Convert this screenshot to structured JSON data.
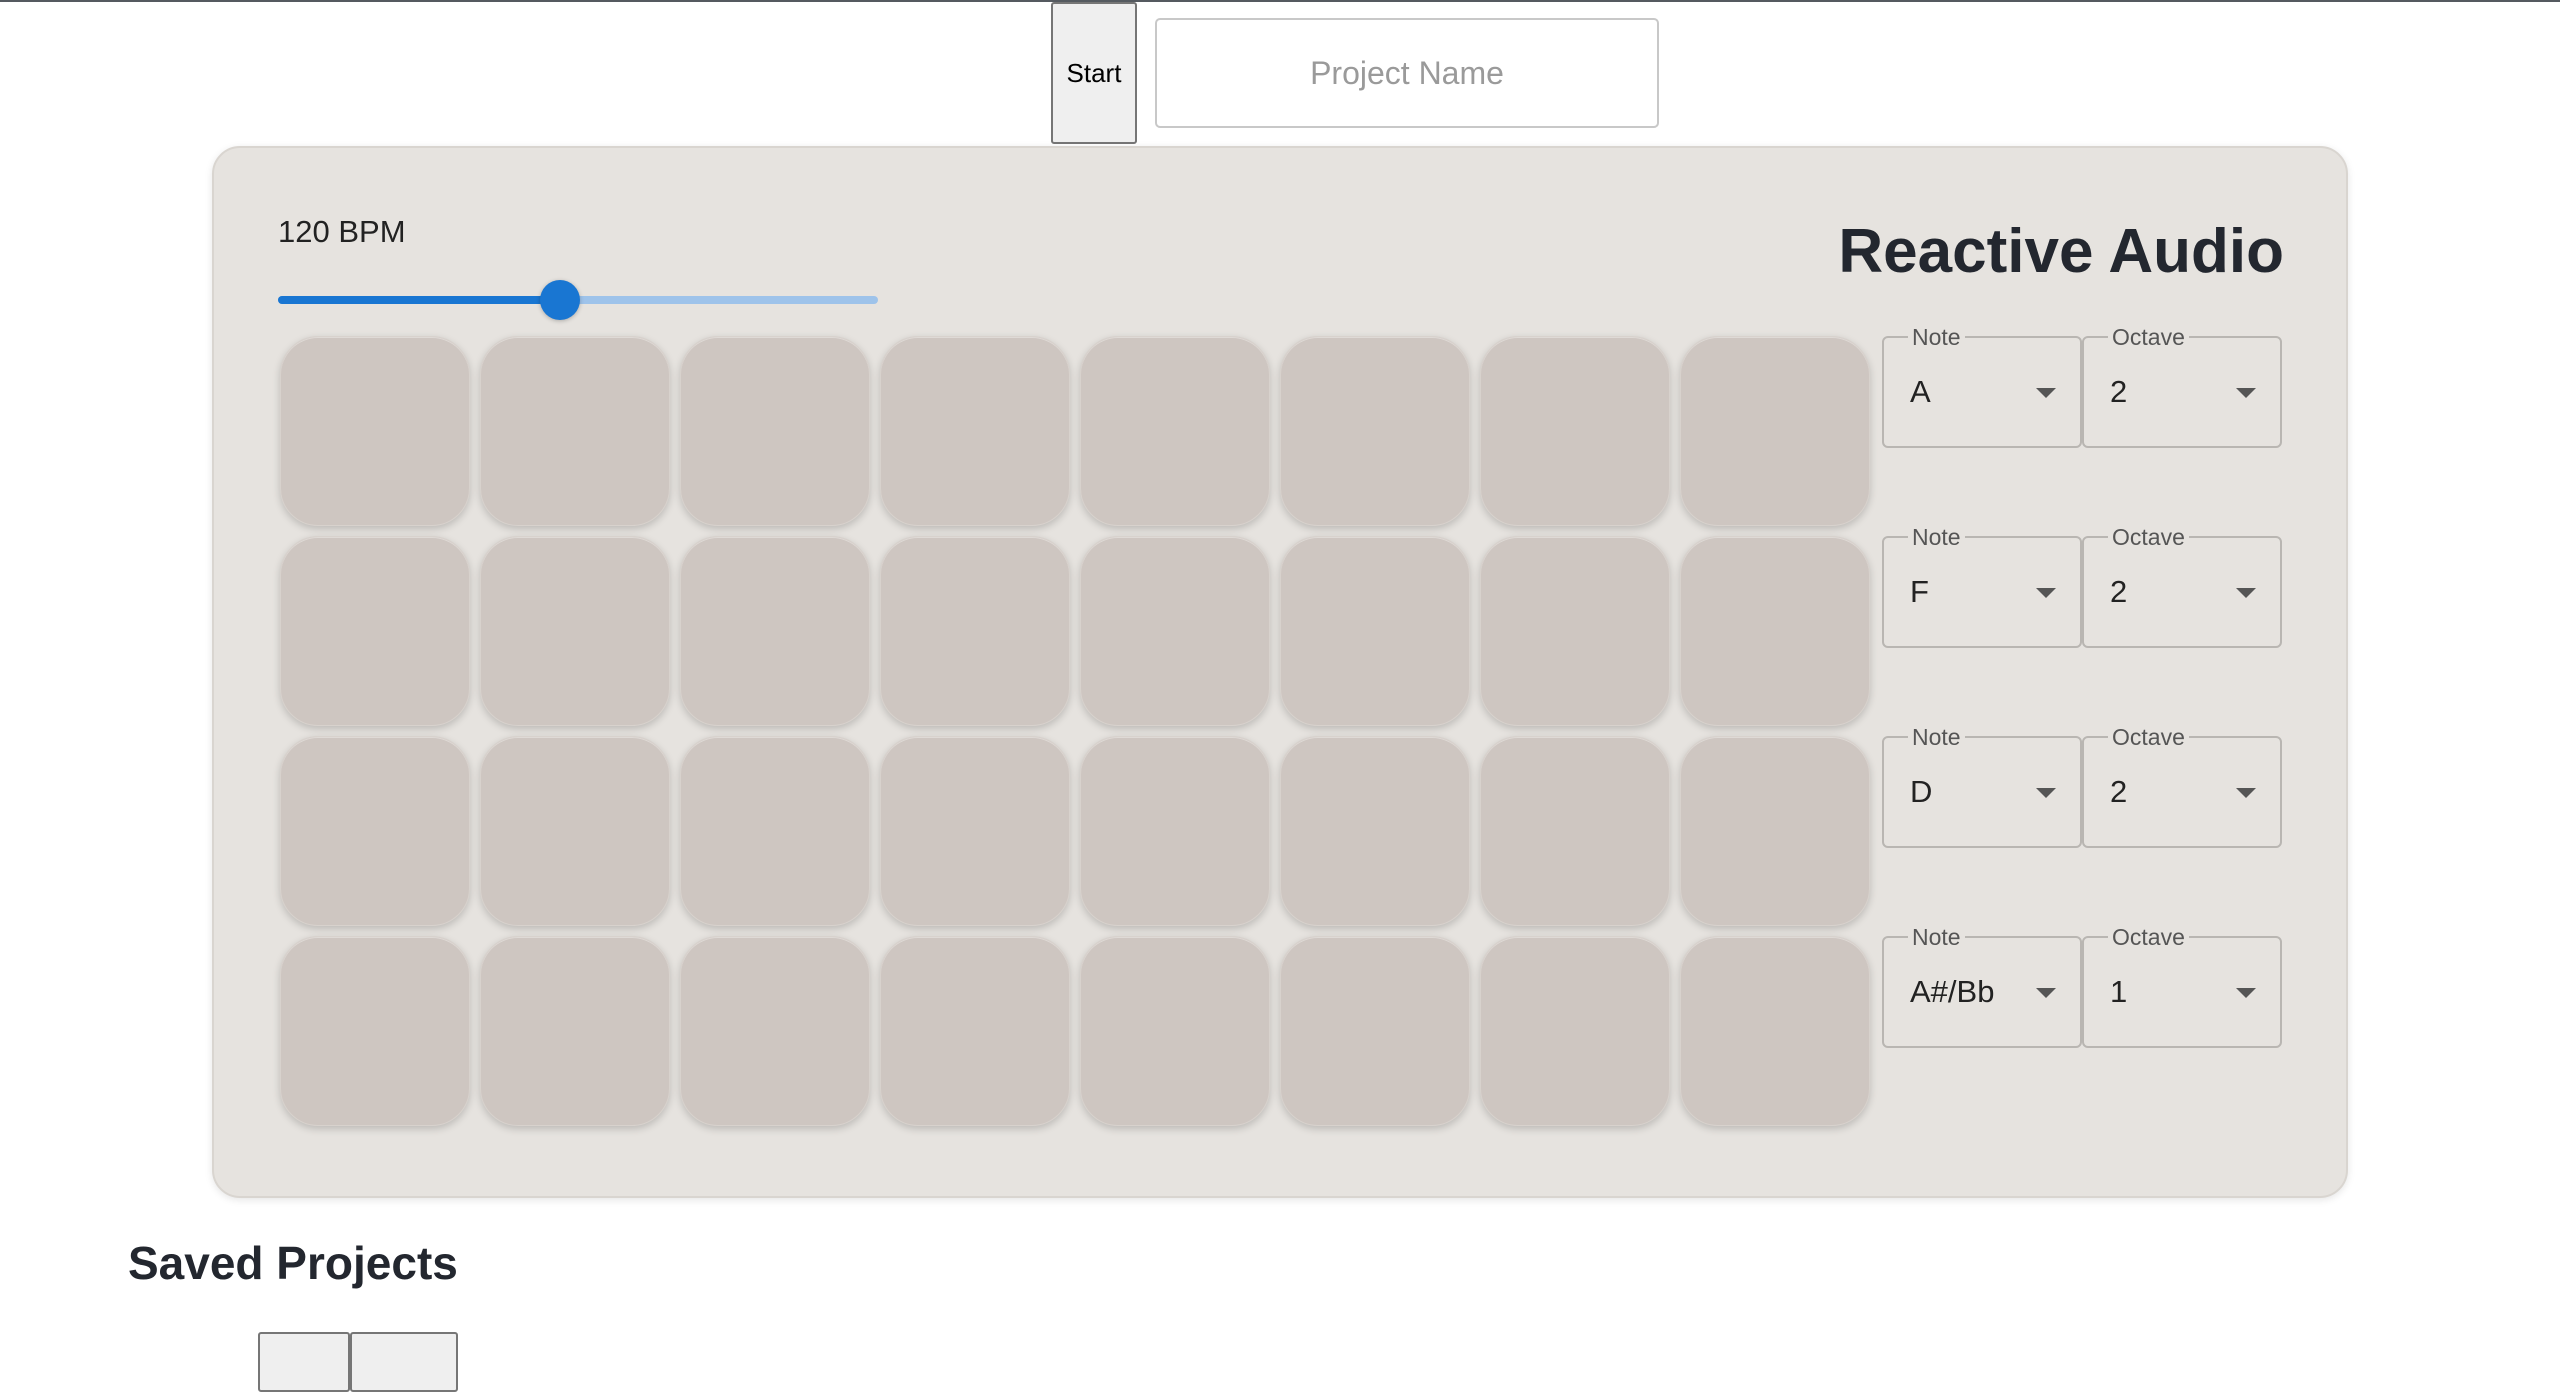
{
  "toolbar": {
    "start_label": "Start",
    "project_name_placeholder": "Project Name",
    "project_name_value": ""
  },
  "sequencer": {
    "bpm_label": "120 BPM",
    "bpm": 120,
    "bpm_slider_fraction": 0.47,
    "title": "Reactive Audio",
    "rows": [
      {
        "note_label": "Note",
        "note": "A",
        "octave_label": "Octave",
        "octave": "2"
      },
      {
        "note_label": "Note",
        "note": "F",
        "octave_label": "Octave",
        "octave": "2"
      },
      {
        "note_label": "Note",
        "note": "D",
        "octave_label": "Octave",
        "octave": "2"
      },
      {
        "note_label": "Note",
        "note": "A#/Bb",
        "octave_label": "Octave",
        "octave": "1"
      }
    ],
    "steps_per_row": 8
  },
  "saved": {
    "title": "Saved Projects",
    "button_count": 2
  },
  "colors": {
    "accent": "#1976d2",
    "panel": "#e6e3df",
    "pad": "#cec6c1"
  }
}
